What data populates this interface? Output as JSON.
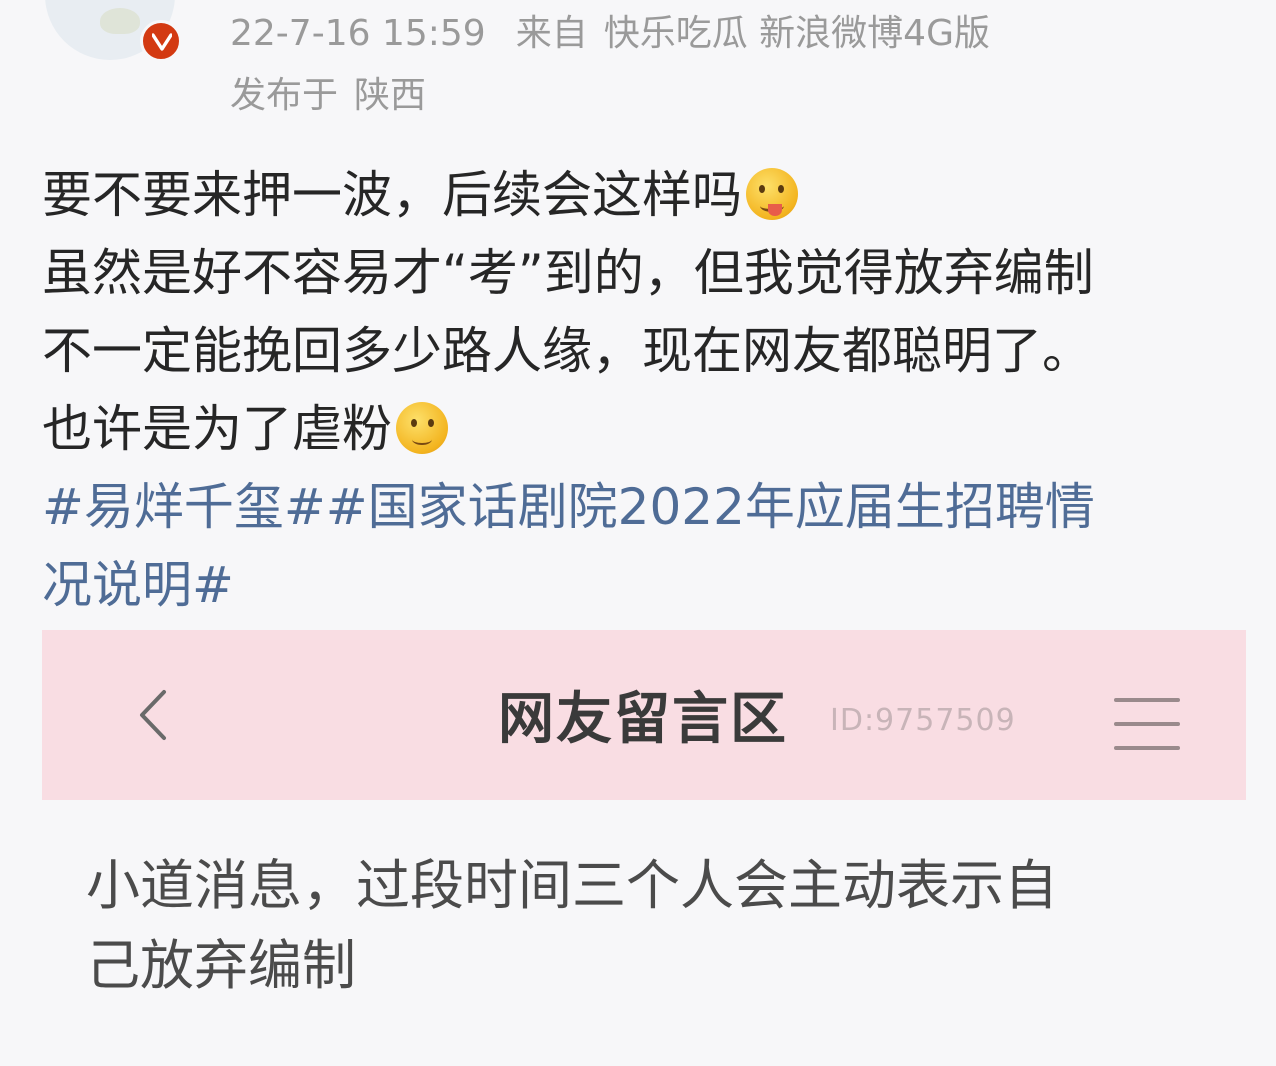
{
  "post_header": {
    "time": "22-7-16 15:59",
    "source_prefix": "来自",
    "source": "快乐吃瓜 新浪微博4G版",
    "location_prefix": "发布于",
    "location": "陕西",
    "badge_icon": "vip-verified-icon",
    "badge_color": "#d33a12"
  },
  "post_body": {
    "line1": "要不要来押一波，后续会这样吗",
    "line1_emoji": "tongue-out-emoji",
    "line2": "虽然是好不容易才“考”到的，但我觉得放弃编制",
    "line3": "不一定能挽回多少路人缘，现在网友都聪明了。",
    "line4": "也许是为了虐粉",
    "line4_emoji": "smirk-emoji",
    "hashtag_line1": "#易烊千玺##国家话剧院2022年应届生招聘情",
    "hashtag_line2": "况说明#",
    "hashtag_color": "#4f6c96"
  },
  "embedded": {
    "bar_color": "#f9dde3",
    "back_icon": "chevron-left-icon",
    "title": "网友留言区",
    "id_text": "ID:9757509",
    "menu_icon": "hamburger-menu-icon",
    "comment_line1": "小道消息，过段时间三个人会主动表示自",
    "comment_line2": "己放弃编制"
  }
}
